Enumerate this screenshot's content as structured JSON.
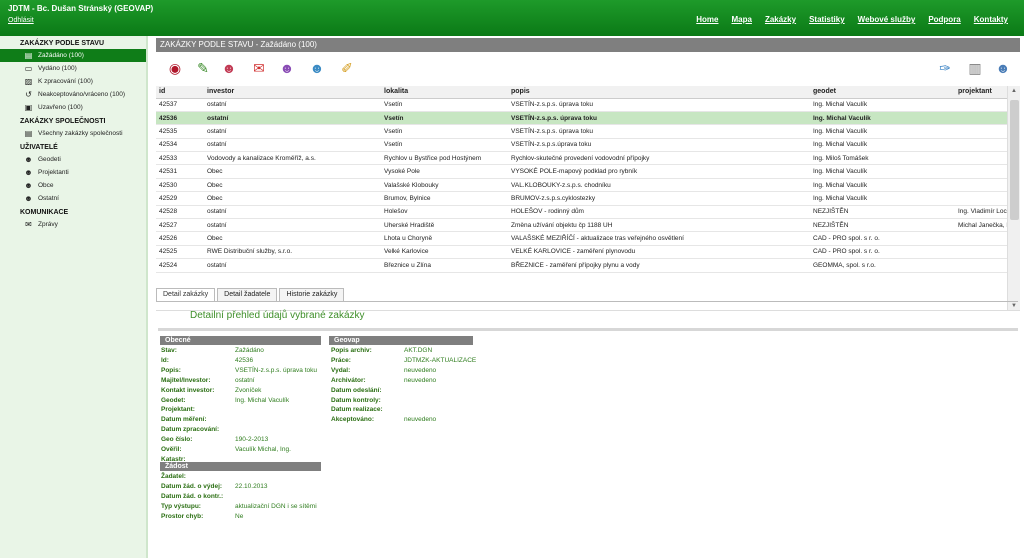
{
  "header": {
    "title": "JDTM - Bc. Dušan Stránský (GEOVAP)",
    "logout": "Odhlásit",
    "nav": [
      "Home",
      "Mapa",
      "Zakázky",
      "Statistiky",
      "Webové služby",
      "Podpora",
      "Kontakty"
    ]
  },
  "sidebar": {
    "sections": [
      {
        "title": "ZAKÁZKY PODLE STAVU",
        "items": [
          {
            "label": "Zažádáno (100)",
            "icon": "folder-open-icon",
            "active": true
          },
          {
            "label": "Vydáno (100)",
            "icon": "document-icon"
          },
          {
            "label": "K zpracování (100)",
            "icon": "task-icon"
          },
          {
            "label": "Neakceptováno/vráceno (100)",
            "icon": "return-icon"
          },
          {
            "label": "Uzavřeno (100)",
            "icon": "lock-icon"
          }
        ]
      },
      {
        "title": "ZAKÁZKY SPOLEČNOSTI",
        "items": [
          {
            "label": "Všechny zakázky společnosti",
            "icon": "folder-icon"
          }
        ]
      },
      {
        "title": "UŽIVATELÉ",
        "items": [
          {
            "label": "Geodeti",
            "icon": "user-icon"
          },
          {
            "label": "Projektanti",
            "icon": "user-icon"
          },
          {
            "label": "Obce",
            "icon": "user-icon"
          },
          {
            "label": "Ostatní",
            "icon": "user-icon"
          }
        ]
      },
      {
        "title": "KOMUNIKACE",
        "items": [
          {
            "label": "Zprávy",
            "icon": "messages-icon"
          }
        ]
      }
    ]
  },
  "main": {
    "title": "ZAKÁZKY PODLE STAVU - Zažádáno (100)",
    "columns": [
      "id",
      "investor",
      "lokalita",
      "popis",
      "geodet",
      "projektant"
    ],
    "rows": [
      [
        "42537",
        "ostatní",
        "Vsetín",
        "VSETÍN-z.s.p.s. úprava toku",
        "Ing. Michal Vaculík",
        ""
      ],
      [
        "42536",
        "ostatní",
        "Vsetín",
        "VSETÍN-z.s.p.s. úprava toku",
        "Ing. Michal Vaculík",
        ""
      ],
      [
        "42535",
        "ostatní",
        "Vsetín",
        "VSETÍN-z.s.p.s. úprava toku",
        "Ing. Michal Vaculík",
        ""
      ],
      [
        "42534",
        "ostatní",
        "Vsetín",
        "VSETÍN-z.s.p.s.úprava toku",
        "Ing. Michal Vaculík",
        ""
      ],
      [
        "42533",
        "Vodovody a kanalizace Kroměříž, a.s.",
        "Rychlov u Bystřice pod Hostýnem",
        "Rychlov-skutečné provedení vodovodní přípojky",
        "Ing. Miloš Tomášek",
        ""
      ],
      [
        "42531",
        "Obec",
        "Vysoké Pole",
        "VYSOKÉ POLE-mapový podklad pro rybník",
        "Ing. Michal Vaculík",
        ""
      ],
      [
        "42530",
        "Obec",
        "Valašské Klobouky",
        "VAL.KLOBOUKY-z.s.p.s. chodníku",
        "Ing. Michal Vaculík",
        ""
      ],
      [
        "42529",
        "Obec",
        "Brumov, Bylnice",
        "BRUMOV-z.s.p.s.cyklostezky",
        "Ing. Michal Vaculík",
        ""
      ],
      [
        "42528",
        "ostatní",
        "Holešov",
        "HOLEŠOV - rodinný dům",
        "NEZJIŠTĚN",
        "Ing. Vladimír Lochman"
      ],
      [
        "42527",
        "ostatní",
        "Uherské Hradiště",
        "Změna užívání objektu čp 1188 UH",
        "NEZJIŠTĚN",
        "Michal Janečka, DiS."
      ],
      [
        "42526",
        "Obec",
        "Lhota u Choryně",
        "VALAŠSKÉ MEZIŘÍČÍ - aktualizace tras veřejného osvětlení",
        "CAD - PRO spol. s r. o.",
        ""
      ],
      [
        "42525",
        "RWE Distribuční služby, s.r.o.",
        "Velké Karlovice",
        "VELKÉ KARLOVICE - zaměření plynovodu",
        "CAD - PRO spol. s r. o.",
        ""
      ],
      [
        "42524",
        "ostatní",
        "Březnice u Zlína",
        "BŘEZNICE - zaměření přípojky plynu a vody",
        "GEOMMA, spol. s r.o.",
        ""
      ]
    ],
    "selected_row": 1,
    "tabs": [
      "Detail zakázky",
      "Detail žadatele",
      "Historie zakázky"
    ],
    "detail_heading": "Detailní přehled údajů vybrané zakázky"
  },
  "detail": {
    "obecne": {
      "title": "Obecné",
      "rows": [
        {
          "k": "Stav:",
          "v": "Zažádáno"
        },
        {
          "k": "Id:",
          "v": "42536"
        },
        {
          "k": "Popis:",
          "v": "VSETÍN-z.s.p.s. úprava toku"
        },
        {
          "k": "Majitel/Investor:",
          "v": "ostatní"
        },
        {
          "k": "Kontakt investor:",
          "v": "Zvoníček"
        },
        {
          "k": "Geodet:",
          "v": "Ing. Michal Vaculík"
        },
        {
          "k": "Projektant:",
          "v": ""
        },
        {
          "k": "Datum měření:",
          "v": ""
        },
        {
          "k": "Datum zpracování:",
          "v": ""
        },
        {
          "k": "Geo číslo:",
          "v": "190-2-2013"
        },
        {
          "k": "Ověřil:",
          "v": "Vaculík Michal, Ing."
        },
        {
          "k": "Katastr:",
          "v": ""
        }
      ]
    },
    "geovap": {
      "title": "Geovap",
      "rows": [
        {
          "k": "Popis archiv:",
          "v": "AKT.DGN"
        },
        {
          "k": "Práce:",
          "v": "JDTMZK-AKTUALIZACE"
        },
        {
          "k": "Vydal:",
          "v": "neuvedeno"
        },
        {
          "k": "Archivátor:",
          "v": "neuvedeno"
        },
        {
          "k": "Datum odeslání:",
          "v": ""
        },
        {
          "k": "Datum kontroly:",
          "v": ""
        },
        {
          "k": "Datum realizace:",
          "v": ""
        },
        {
          "k": "Akceptováno:",
          "v": "neuvedeno"
        }
      ]
    },
    "zadost": {
      "title": "Žádost",
      "rows": [
        {
          "k": "Žadatel:",
          "v": ""
        },
        {
          "k": "Datum žád. o výdej:",
          "v": "22.10.2013"
        },
        {
          "k": "Datum žád. o kontr.:",
          "v": ""
        },
        {
          "k": "Typ výstupu:",
          "v": "aktualizační DGN i se sítěmi"
        },
        {
          "k": "Prostor chyb:",
          "v": "Ne"
        }
      ]
    }
  }
}
